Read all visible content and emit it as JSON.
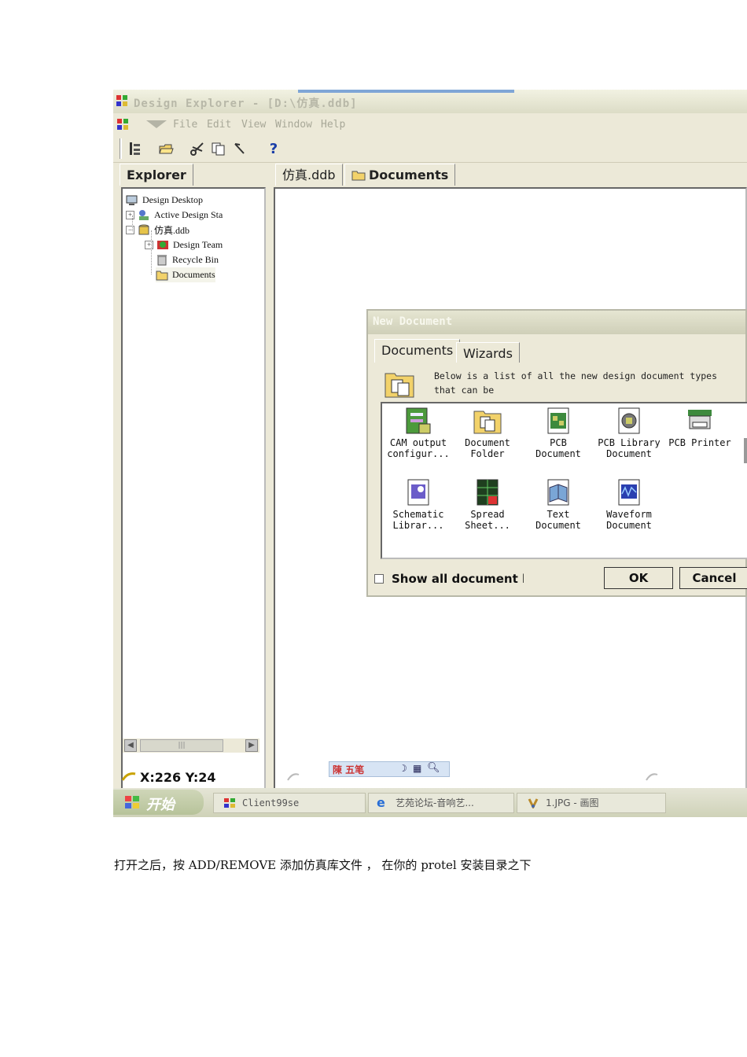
{
  "window": {
    "title": "Design Explorer - [D:\\仿真.ddb]",
    "menu": [
      "File",
      "Edit",
      "View",
      "Window",
      "Help"
    ]
  },
  "explorer": {
    "tab_label": "Explorer",
    "tree": [
      {
        "label": "Design Desktop"
      },
      {
        "label": "Active Design Sta"
      },
      {
        "label": "仿真.ddb"
      },
      {
        "label": "Design Team"
      },
      {
        "label": "Recycle Bin"
      },
      {
        "label": "Documents"
      }
    ],
    "scroll_thumb": "|||"
  },
  "main_tabs": [
    "仿真.ddb",
    "Documents"
  ],
  "dialog": {
    "title": "New Document",
    "tabs": [
      "Documents",
      "Wizards"
    ],
    "description_line1": "Below is a list of all  the new design document types",
    "description_line2": "that can be",
    "items": [
      {
        "line1": "CAM output",
        "line2": "configur..."
      },
      {
        "line1": "Document",
        "line2": "Folder"
      },
      {
        "line1": "PCB",
        "line2": "Document"
      },
      {
        "line1": "PCB Library",
        "line2": "Document"
      },
      {
        "line1": "PCB Printer",
        "line2": ""
      },
      {
        "line1": "Schematic",
        "line2": "Librar..."
      },
      {
        "line1": "Spread",
        "line2": "Sheet..."
      },
      {
        "line1": "Text",
        "line2": "Document"
      },
      {
        "line1": "Waveform",
        "line2": "Document"
      }
    ],
    "checkbox_label": "Show all document ki",
    "ok_label": "OK",
    "cancel_label": "Cancel"
  },
  "status": {
    "coords": "X:226 Y:24",
    "ime_text": "陳 五笔"
  },
  "taskbar": {
    "start_label": "开始",
    "tasks": [
      "Client99se",
      "艺苑论坛-音响艺...",
      "1.JPG - 画图"
    ]
  },
  "caption": "打开之后，按 ADD/REMOVE 添加仿真库文件 ， 在你的 protel 安装目录之下",
  "colors": {
    "window_bg": "#ece9d8",
    "accent_blue": "#1a3ea8",
    "taskbar": "#d6d8c2"
  }
}
